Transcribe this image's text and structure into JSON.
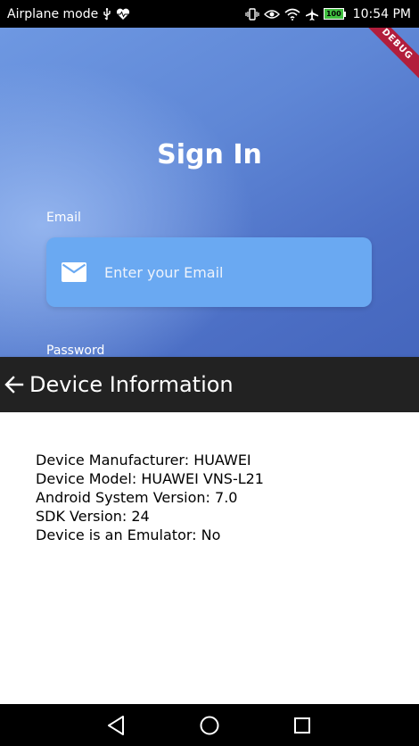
{
  "status_bar": {
    "left_text": "Airplane mode",
    "battery_level": "100",
    "time": "10:54 PM",
    "icons_left": [
      "usb-icon",
      "heart-icon"
    ],
    "icons_right": [
      "vibrate-icon",
      "eye-icon",
      "wifi-icon",
      "airplane-icon",
      "battery-icon"
    ]
  },
  "signin": {
    "title": "Sign In",
    "email_label": "Email",
    "email_placeholder": "Enter your Email",
    "password_label": "Password",
    "debug_banner": "DEBUG"
  },
  "device_info": {
    "title": "Device Information",
    "lines": [
      "Device Manufacturer: HUAWEI",
      "Device Model: HUAWEI VNS-L21",
      "Android System Version: 7.0",
      "SDK Version: 24",
      "Device is an Emulator: No"
    ]
  },
  "nav_bar": {
    "buttons": [
      "back-icon",
      "home-icon",
      "recents-icon"
    ]
  },
  "colors": {
    "app_bar": "#222222",
    "gradient_top": "#6e98e2",
    "gradient_bottom": "#4566bd",
    "email_field": "#6aa9f2",
    "debug_ribbon": "#b21e3c"
  }
}
